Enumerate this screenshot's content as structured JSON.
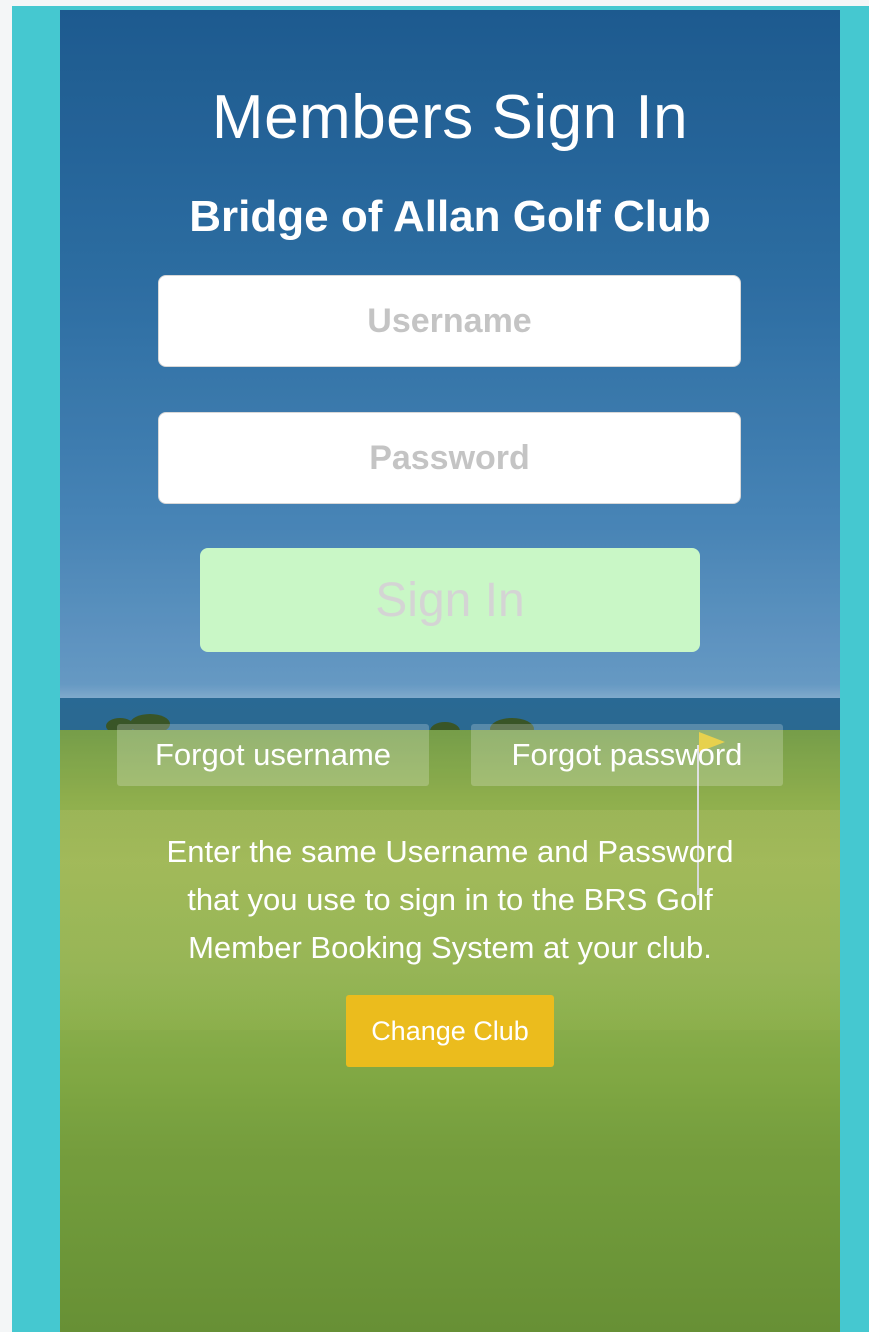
{
  "page": {
    "title": "Members Sign In",
    "club_name": "Bridge of Allan Golf Club"
  },
  "form": {
    "username_placeholder": "Username",
    "username_value": "",
    "password_placeholder": "Password",
    "password_value": "",
    "sign_in_label": "Sign In"
  },
  "links": {
    "forgot_username": "Forgot username",
    "forgot_password": "Forgot password"
  },
  "info": {
    "lines": [
      "Enter the same Username and Password",
      "that you use to sign in to the BRS Golf",
      "Member Booking System at your club."
    ]
  },
  "actions": {
    "change_club": "Change Club"
  },
  "colors": {
    "frame_teal": "#45c8d0",
    "sign_in_bg": "#c9f7c6",
    "change_club_bg": "#ebbc1d",
    "flag": "#f2d21a"
  },
  "icons": {
    "background_flag": "golf-flag-icon"
  }
}
